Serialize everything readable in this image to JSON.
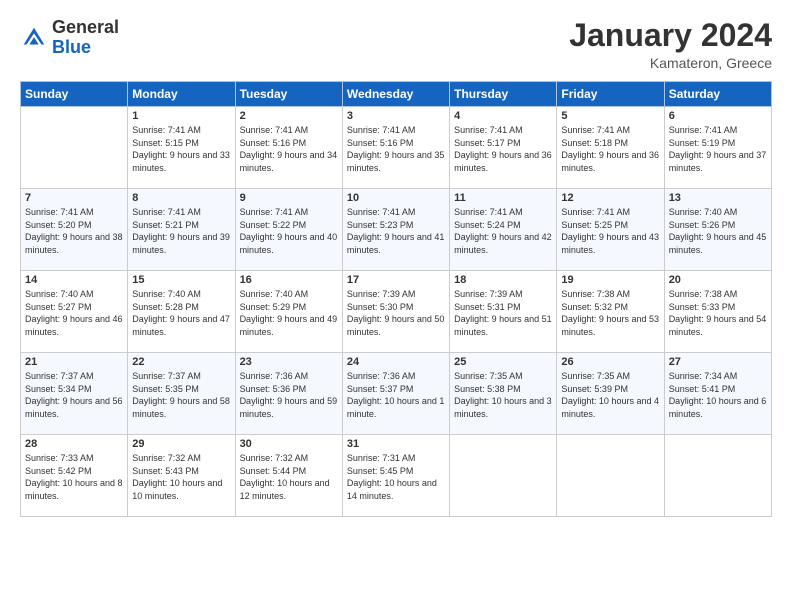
{
  "header": {
    "logo_general": "General",
    "logo_blue": "Blue",
    "month_title": "January 2024",
    "location": "Kamateron, Greece"
  },
  "weekdays": [
    "Sunday",
    "Monday",
    "Tuesday",
    "Wednesday",
    "Thursday",
    "Friday",
    "Saturday"
  ],
  "weeks": [
    [
      {
        "day": "",
        "sunrise": "",
        "sunset": "",
        "daylight": ""
      },
      {
        "day": "1",
        "sunrise": "Sunrise: 7:41 AM",
        "sunset": "Sunset: 5:15 PM",
        "daylight": "Daylight: 9 hours and 33 minutes."
      },
      {
        "day": "2",
        "sunrise": "Sunrise: 7:41 AM",
        "sunset": "Sunset: 5:16 PM",
        "daylight": "Daylight: 9 hours and 34 minutes."
      },
      {
        "day": "3",
        "sunrise": "Sunrise: 7:41 AM",
        "sunset": "Sunset: 5:16 PM",
        "daylight": "Daylight: 9 hours and 35 minutes."
      },
      {
        "day": "4",
        "sunrise": "Sunrise: 7:41 AM",
        "sunset": "Sunset: 5:17 PM",
        "daylight": "Daylight: 9 hours and 36 minutes."
      },
      {
        "day": "5",
        "sunrise": "Sunrise: 7:41 AM",
        "sunset": "Sunset: 5:18 PM",
        "daylight": "Daylight: 9 hours and 36 minutes."
      },
      {
        "day": "6",
        "sunrise": "Sunrise: 7:41 AM",
        "sunset": "Sunset: 5:19 PM",
        "daylight": "Daylight: 9 hours and 37 minutes."
      }
    ],
    [
      {
        "day": "7",
        "sunrise": "Sunrise: 7:41 AM",
        "sunset": "Sunset: 5:20 PM",
        "daylight": "Daylight: 9 hours and 38 minutes."
      },
      {
        "day": "8",
        "sunrise": "Sunrise: 7:41 AM",
        "sunset": "Sunset: 5:21 PM",
        "daylight": "Daylight: 9 hours and 39 minutes."
      },
      {
        "day": "9",
        "sunrise": "Sunrise: 7:41 AM",
        "sunset": "Sunset: 5:22 PM",
        "daylight": "Daylight: 9 hours and 40 minutes."
      },
      {
        "day": "10",
        "sunrise": "Sunrise: 7:41 AM",
        "sunset": "Sunset: 5:23 PM",
        "daylight": "Daylight: 9 hours and 41 minutes."
      },
      {
        "day": "11",
        "sunrise": "Sunrise: 7:41 AM",
        "sunset": "Sunset: 5:24 PM",
        "daylight": "Daylight: 9 hours and 42 minutes."
      },
      {
        "day": "12",
        "sunrise": "Sunrise: 7:41 AM",
        "sunset": "Sunset: 5:25 PM",
        "daylight": "Daylight: 9 hours and 43 minutes."
      },
      {
        "day": "13",
        "sunrise": "Sunrise: 7:40 AM",
        "sunset": "Sunset: 5:26 PM",
        "daylight": "Daylight: 9 hours and 45 minutes."
      }
    ],
    [
      {
        "day": "14",
        "sunrise": "Sunrise: 7:40 AM",
        "sunset": "Sunset: 5:27 PM",
        "daylight": "Daylight: 9 hours and 46 minutes."
      },
      {
        "day": "15",
        "sunrise": "Sunrise: 7:40 AM",
        "sunset": "Sunset: 5:28 PM",
        "daylight": "Daylight: 9 hours and 47 minutes."
      },
      {
        "day": "16",
        "sunrise": "Sunrise: 7:40 AM",
        "sunset": "Sunset: 5:29 PM",
        "daylight": "Daylight: 9 hours and 49 minutes."
      },
      {
        "day": "17",
        "sunrise": "Sunrise: 7:39 AM",
        "sunset": "Sunset: 5:30 PM",
        "daylight": "Daylight: 9 hours and 50 minutes."
      },
      {
        "day": "18",
        "sunrise": "Sunrise: 7:39 AM",
        "sunset": "Sunset: 5:31 PM",
        "daylight": "Daylight: 9 hours and 51 minutes."
      },
      {
        "day": "19",
        "sunrise": "Sunrise: 7:38 AM",
        "sunset": "Sunset: 5:32 PM",
        "daylight": "Daylight: 9 hours and 53 minutes."
      },
      {
        "day": "20",
        "sunrise": "Sunrise: 7:38 AM",
        "sunset": "Sunset: 5:33 PM",
        "daylight": "Daylight: 9 hours and 54 minutes."
      }
    ],
    [
      {
        "day": "21",
        "sunrise": "Sunrise: 7:37 AM",
        "sunset": "Sunset: 5:34 PM",
        "daylight": "Daylight: 9 hours and 56 minutes."
      },
      {
        "day": "22",
        "sunrise": "Sunrise: 7:37 AM",
        "sunset": "Sunset: 5:35 PM",
        "daylight": "Daylight: 9 hours and 58 minutes."
      },
      {
        "day": "23",
        "sunrise": "Sunrise: 7:36 AM",
        "sunset": "Sunset: 5:36 PM",
        "daylight": "Daylight: 9 hours and 59 minutes."
      },
      {
        "day": "24",
        "sunrise": "Sunrise: 7:36 AM",
        "sunset": "Sunset: 5:37 PM",
        "daylight": "Daylight: 10 hours and 1 minute."
      },
      {
        "day": "25",
        "sunrise": "Sunrise: 7:35 AM",
        "sunset": "Sunset: 5:38 PM",
        "daylight": "Daylight: 10 hours and 3 minutes."
      },
      {
        "day": "26",
        "sunrise": "Sunrise: 7:35 AM",
        "sunset": "Sunset: 5:39 PM",
        "daylight": "Daylight: 10 hours and 4 minutes."
      },
      {
        "day": "27",
        "sunrise": "Sunrise: 7:34 AM",
        "sunset": "Sunset: 5:41 PM",
        "daylight": "Daylight: 10 hours and 6 minutes."
      }
    ],
    [
      {
        "day": "28",
        "sunrise": "Sunrise: 7:33 AM",
        "sunset": "Sunset: 5:42 PM",
        "daylight": "Daylight: 10 hours and 8 minutes."
      },
      {
        "day": "29",
        "sunrise": "Sunrise: 7:32 AM",
        "sunset": "Sunset: 5:43 PM",
        "daylight": "Daylight: 10 hours and 10 minutes."
      },
      {
        "day": "30",
        "sunrise": "Sunrise: 7:32 AM",
        "sunset": "Sunset: 5:44 PM",
        "daylight": "Daylight: 10 hours and 12 minutes."
      },
      {
        "day": "31",
        "sunrise": "Sunrise: 7:31 AM",
        "sunset": "Sunset: 5:45 PM",
        "daylight": "Daylight: 10 hours and 14 minutes."
      },
      {
        "day": "",
        "sunrise": "",
        "sunset": "",
        "daylight": ""
      },
      {
        "day": "",
        "sunrise": "",
        "sunset": "",
        "daylight": ""
      },
      {
        "day": "",
        "sunrise": "",
        "sunset": "",
        "daylight": ""
      }
    ]
  ]
}
